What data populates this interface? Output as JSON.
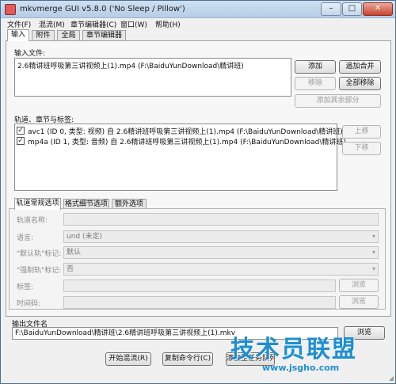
{
  "window": {
    "title": "mkvmerge GUI v5.8.0 ('No Sleep / Pillow')",
    "minimize_label": "–",
    "maximize_label": "□",
    "close_label": "✕"
  },
  "menu": [
    "文件(F)",
    "混流(M)",
    "章节编辑器(C)",
    "窗口(W)",
    "帮助(H)"
  ],
  "tabs": [
    "输入",
    "附件",
    "全局",
    "章节编辑器"
  ],
  "input": {
    "files_label": "输入文件:",
    "files": [
      "2.6精讲班呼吸第三讲视频上(1).mp4 (F:\\BaiduYunDownload\\精讲班)"
    ],
    "add_button": "添加",
    "append_button": "追加合并",
    "remove_button": "移除",
    "remove_all_button": "全部移除",
    "add_other_button": "添加其余部分",
    "tracks_label": "轨道、章节与标签:",
    "tracks": [
      {
        "checked": true,
        "text": "avc1 (ID 0, 类型: 视频) 自 2.6精讲班呼吸第三讲视频上(1).mp4 (F:\\BaiduYunDownload\\精讲班)"
      },
      {
        "checked": true,
        "text": "mp4a (ID 1, 类型: 音频) 自 2.6精讲班呼吸第三讲视频上(1).mp4 (F:\\BaiduYunDownload\\精讲班)"
      }
    ],
    "up_button": "上移",
    "down_button": "下移",
    "subtabs": [
      "轨道常规选项",
      "格式细节选项",
      "额外选项"
    ],
    "fields": {
      "track_name_label": "轨道名称:",
      "track_name_value": "",
      "language_label": "语言:",
      "language_value": "und (未定)",
      "default_flag_label": "\"默认轨\"标记:",
      "default_flag_value": "默认",
      "forced_flag_label": "\"强制轨\"标记:",
      "forced_flag_value": "否",
      "tags_label": "标签:",
      "tags_value": "",
      "tags_browse": "浏览",
      "timecodes_label": "时间码:",
      "timecodes_value": "",
      "timecodes_browse": "浏览"
    }
  },
  "output": {
    "label": "输出文件名",
    "value": "F:\\BaiduYunDownload\\精讲班\\2.6精讲班呼吸第三讲视频上(1).mkv",
    "browse_button": "浏览",
    "start_mux_button": "开始混流(R)",
    "copy_cmd_button": "复制命令行(C)",
    "add_job_button": "添加至任务队列"
  },
  "watermark": {
    "title": "技术员联盟",
    "url": "www.jsgho.com"
  },
  "colors": {
    "accent": "#1e8fd0",
    "close": "#c8452e"
  }
}
